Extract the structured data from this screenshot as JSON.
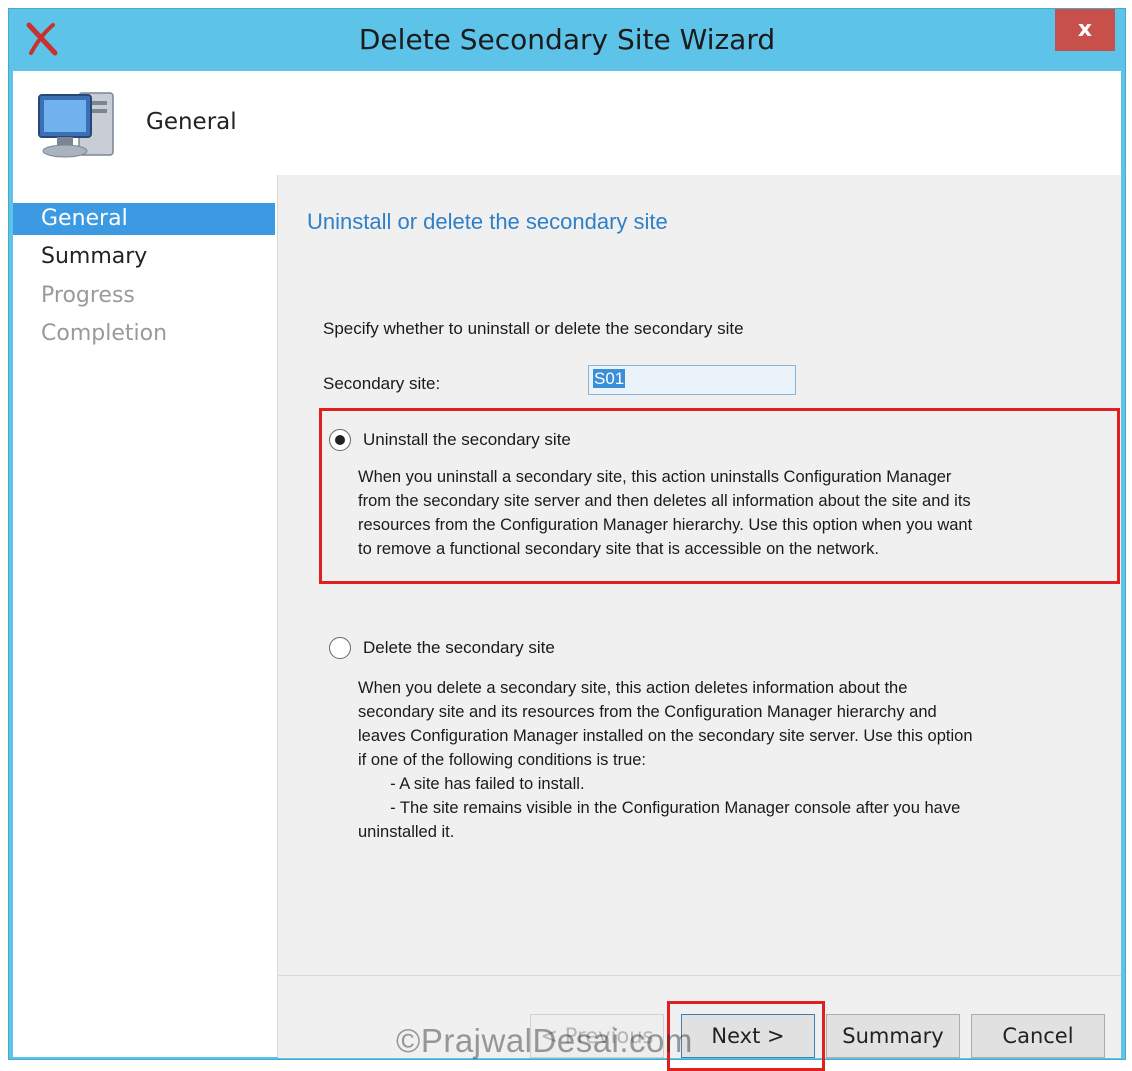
{
  "window": {
    "title": "Delete Secondary Site Wizard",
    "close_label": "x",
    "titlebar_color": "#5ec3e8"
  },
  "header": {
    "title": "General",
    "icon": "computer-icon"
  },
  "nav": {
    "items": [
      {
        "label": "General",
        "state": "active"
      },
      {
        "label": "Summary",
        "state": "normal"
      },
      {
        "label": "Progress",
        "state": "disabled"
      },
      {
        "label": "Completion",
        "state": "disabled"
      }
    ]
  },
  "content": {
    "heading": "Uninstall or delete the secondary site",
    "instruction": "Specify whether to uninstall or delete the secondary site",
    "secondary_site_label": "Secondary site:",
    "secondary_site_value": "S01",
    "options": [
      {
        "label": "Uninstall the secondary site",
        "selected": true,
        "description": "When you uninstall a secondary site, this action uninstalls Configuration Manager\nfrom the secondary site server and then deletes all information about the site and its\nresources from the Configuration Manager hierarchy. Use this option when you want\nto remove a functional secondary site that is accessible on the network."
      },
      {
        "label": "Delete the secondary site",
        "selected": false,
        "description": "When you delete a secondary site, this action deletes information about the\nsecondary site and its resources from the Configuration Manager hierarchy and\nleaves Configuration Manager installed on the secondary site server. Use this option\nif one of the following conditions is true:\n       - A site has failed to install.\n       - The site remains visible in the Configuration Manager console after you have\nuninstalled it."
      }
    ]
  },
  "buttons": {
    "previous": "< Previous",
    "next": "Next >",
    "summary": "Summary",
    "cancel": "Cancel"
  },
  "watermark": "©PrajwalDesai.com",
  "colors": {
    "accent": "#3b9ae1",
    "heading": "#2f7fc8",
    "highlight": "#e02020"
  }
}
